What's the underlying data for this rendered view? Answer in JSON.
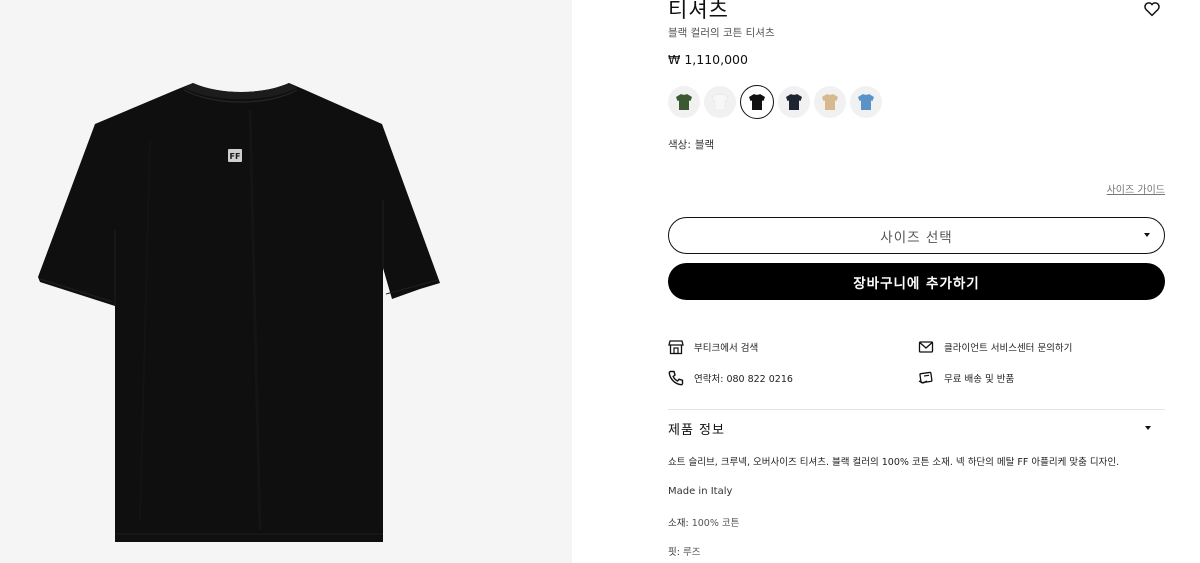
{
  "product": {
    "title": "티셔츠",
    "subtitle": "블랙 컬러의 코튼 티셔츠",
    "price": "₩ 1,110,000",
    "logo_letters": "FF"
  },
  "colors": {
    "swatches": [
      {
        "name": "green",
        "hex": "#3b5a32"
      },
      {
        "name": "white",
        "hex": "#f7f7f7"
      },
      {
        "name": "black",
        "hex": "#111111",
        "selected": true
      },
      {
        "name": "navy",
        "hex": "#1f2433"
      },
      {
        "name": "beige",
        "hex": "#d7b98e"
      },
      {
        "name": "blue",
        "hex": "#5b93c8"
      }
    ],
    "label": "색상:",
    "selected": "블랙"
  },
  "size": {
    "guide_label": "사이즈 가이드",
    "select_label": "사이즈 선택"
  },
  "cart": {
    "add_label": "장바구니에 추가하기"
  },
  "services": {
    "boutique": "부티크에서 검색",
    "client_center": "클라이언트 서비스센터 문의하기",
    "phone": "연락처: 080 822 0216",
    "shipping": "무료 배송 및 반품"
  },
  "details": {
    "heading": "제품 정보",
    "description": "쇼트 슬리브, 크루넥, 오버사이즈 티셔츠. 블랙 컬러의 100% 코튼 소재. 넥 하단의 메탈 FF 아플리케 맞춤 디자인.",
    "made_in": "Made in Italy",
    "material_label": "소재:",
    "material_value": "100% 코튼",
    "fit_label": "핏:",
    "fit_value": "루즈"
  },
  "icons": [
    "heart-icon",
    "store-icon",
    "mail-icon",
    "phone-icon",
    "delivery-icon",
    "chevron-down-icon"
  ]
}
